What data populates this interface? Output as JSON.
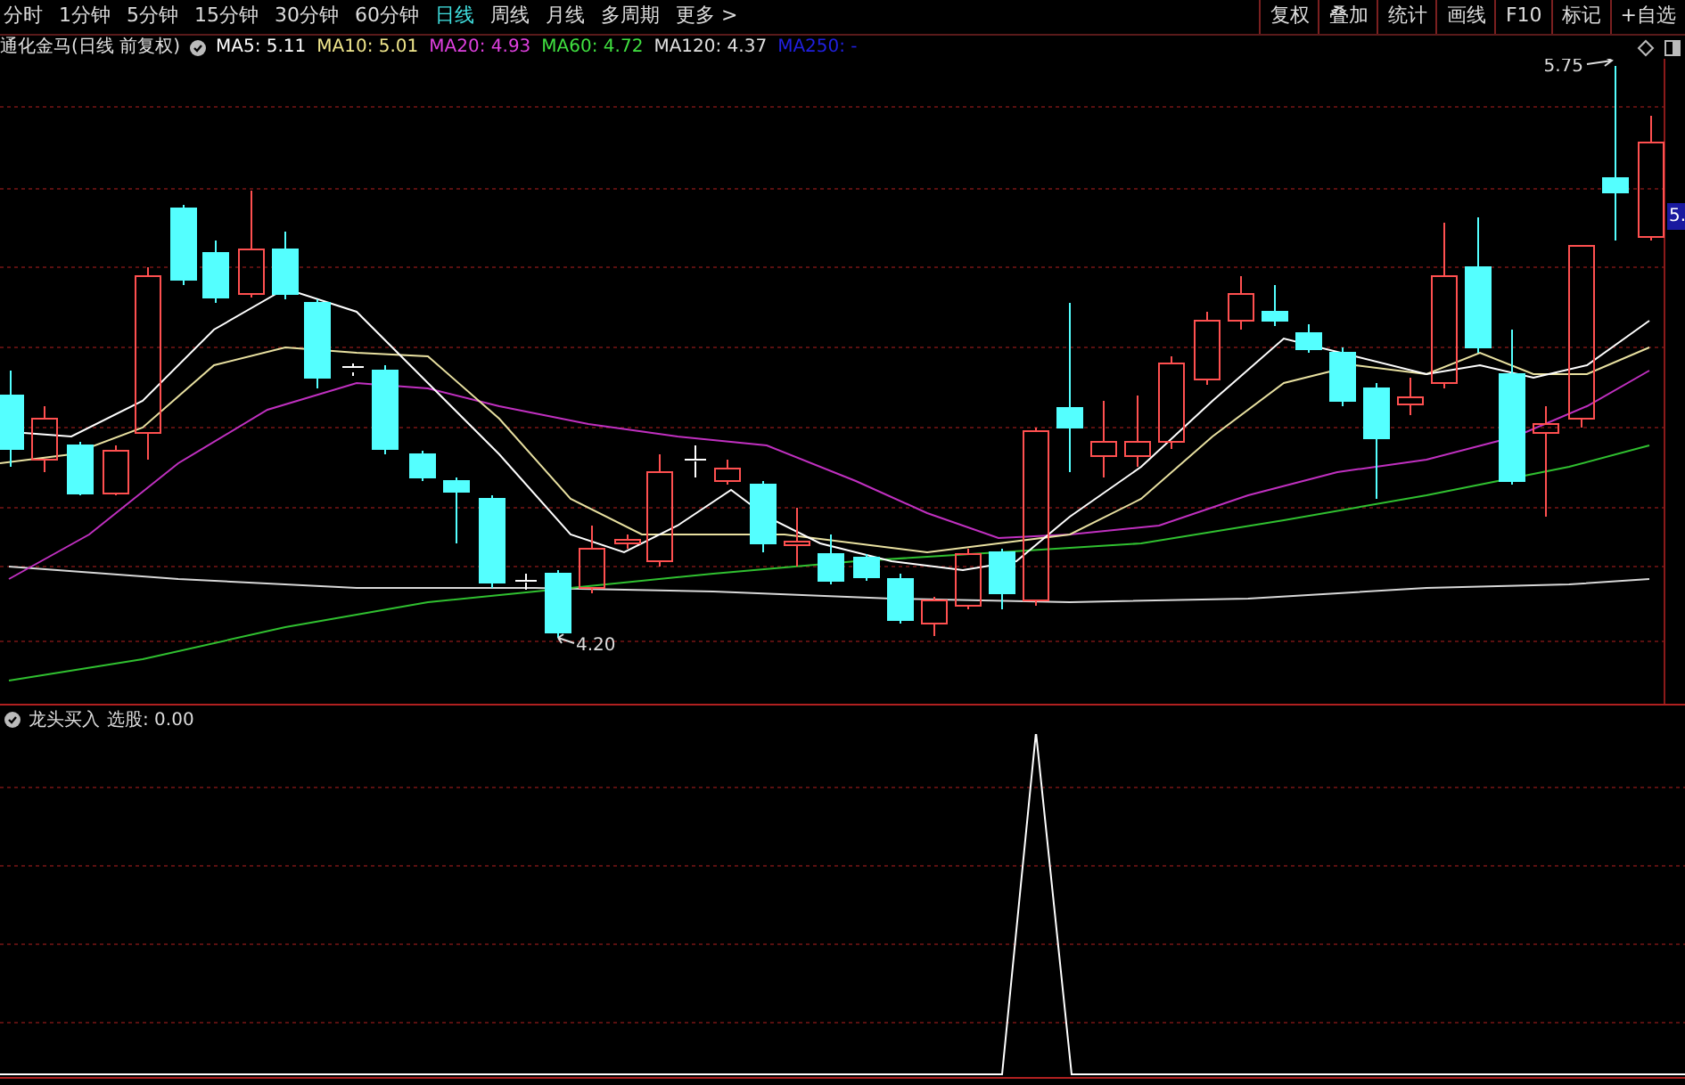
{
  "period_tabs": [
    {
      "label": "分时",
      "selected": false
    },
    {
      "label": "1分钟",
      "selected": false
    },
    {
      "label": "5分钟",
      "selected": false
    },
    {
      "label": "15分钟",
      "selected": false
    },
    {
      "label": "30分钟",
      "selected": false
    },
    {
      "label": "60分钟",
      "selected": false
    },
    {
      "label": "日线",
      "selected": true
    },
    {
      "label": "周线",
      "selected": false
    },
    {
      "label": "月线",
      "selected": false
    },
    {
      "label": "多周期",
      "selected": false
    },
    {
      "label": "更多 >",
      "selected": false
    }
  ],
  "tool_buttons": [
    "复权",
    "叠加",
    "统计",
    "画线",
    "F10",
    "标记",
    "+自选"
  ],
  "stock_title": "通化金马(日线 前复权)",
  "ma_legend": [
    {
      "label": "MA5: 5.11",
      "color": "#ffffff"
    },
    {
      "label": "MA10: 5.01",
      "color": "#f0e68c"
    },
    {
      "label": "MA20: 4.93",
      "color": "#e040e0"
    },
    {
      "label": "MA60: 4.72",
      "color": "#40e040"
    },
    {
      "label": "MA120: 4.37",
      "color": "#e0e0e0"
    },
    {
      "label": "MA250: -",
      "color": "#2020e0"
    }
  ],
  "high_annotation": "5.75",
  "low_annotation": "4.20",
  "price_tag": "5.",
  "indicator": {
    "name": "龙头买入",
    "value": "选股: 0.00"
  }
}
